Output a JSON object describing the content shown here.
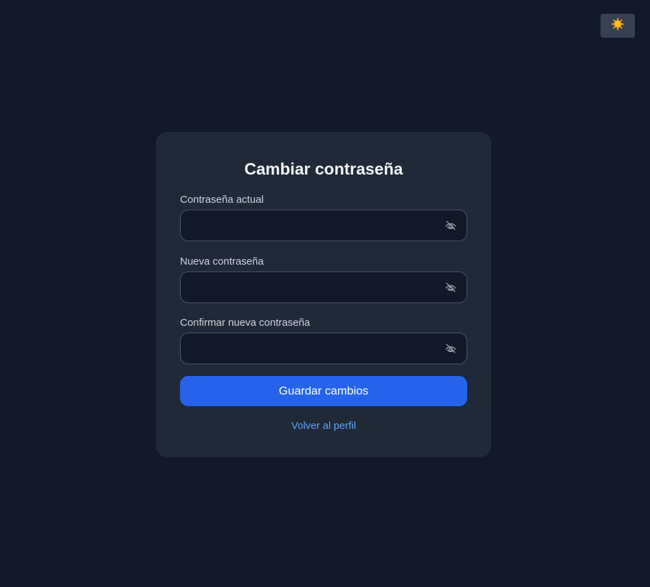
{
  "theme_toggle": {
    "icon": "sun-icon"
  },
  "form": {
    "title": "Cambiar contraseña",
    "fields": [
      {
        "label": "Contraseña actual",
        "value": "",
        "icon": "eye-off-icon"
      },
      {
        "label": "Nueva contraseña",
        "value": "",
        "icon": "eye-off-icon"
      },
      {
        "label": "Confirmar nueva contraseña",
        "value": "",
        "icon": "eye-off-icon"
      }
    ],
    "submit_label": "Guardar cambios",
    "back_link": "Volver al perfil"
  },
  "colors": {
    "background": "#111827",
    "card": "#1f2937",
    "primary": "#2563eb",
    "link": "#60a5fa",
    "sun": "#f59e0b"
  }
}
